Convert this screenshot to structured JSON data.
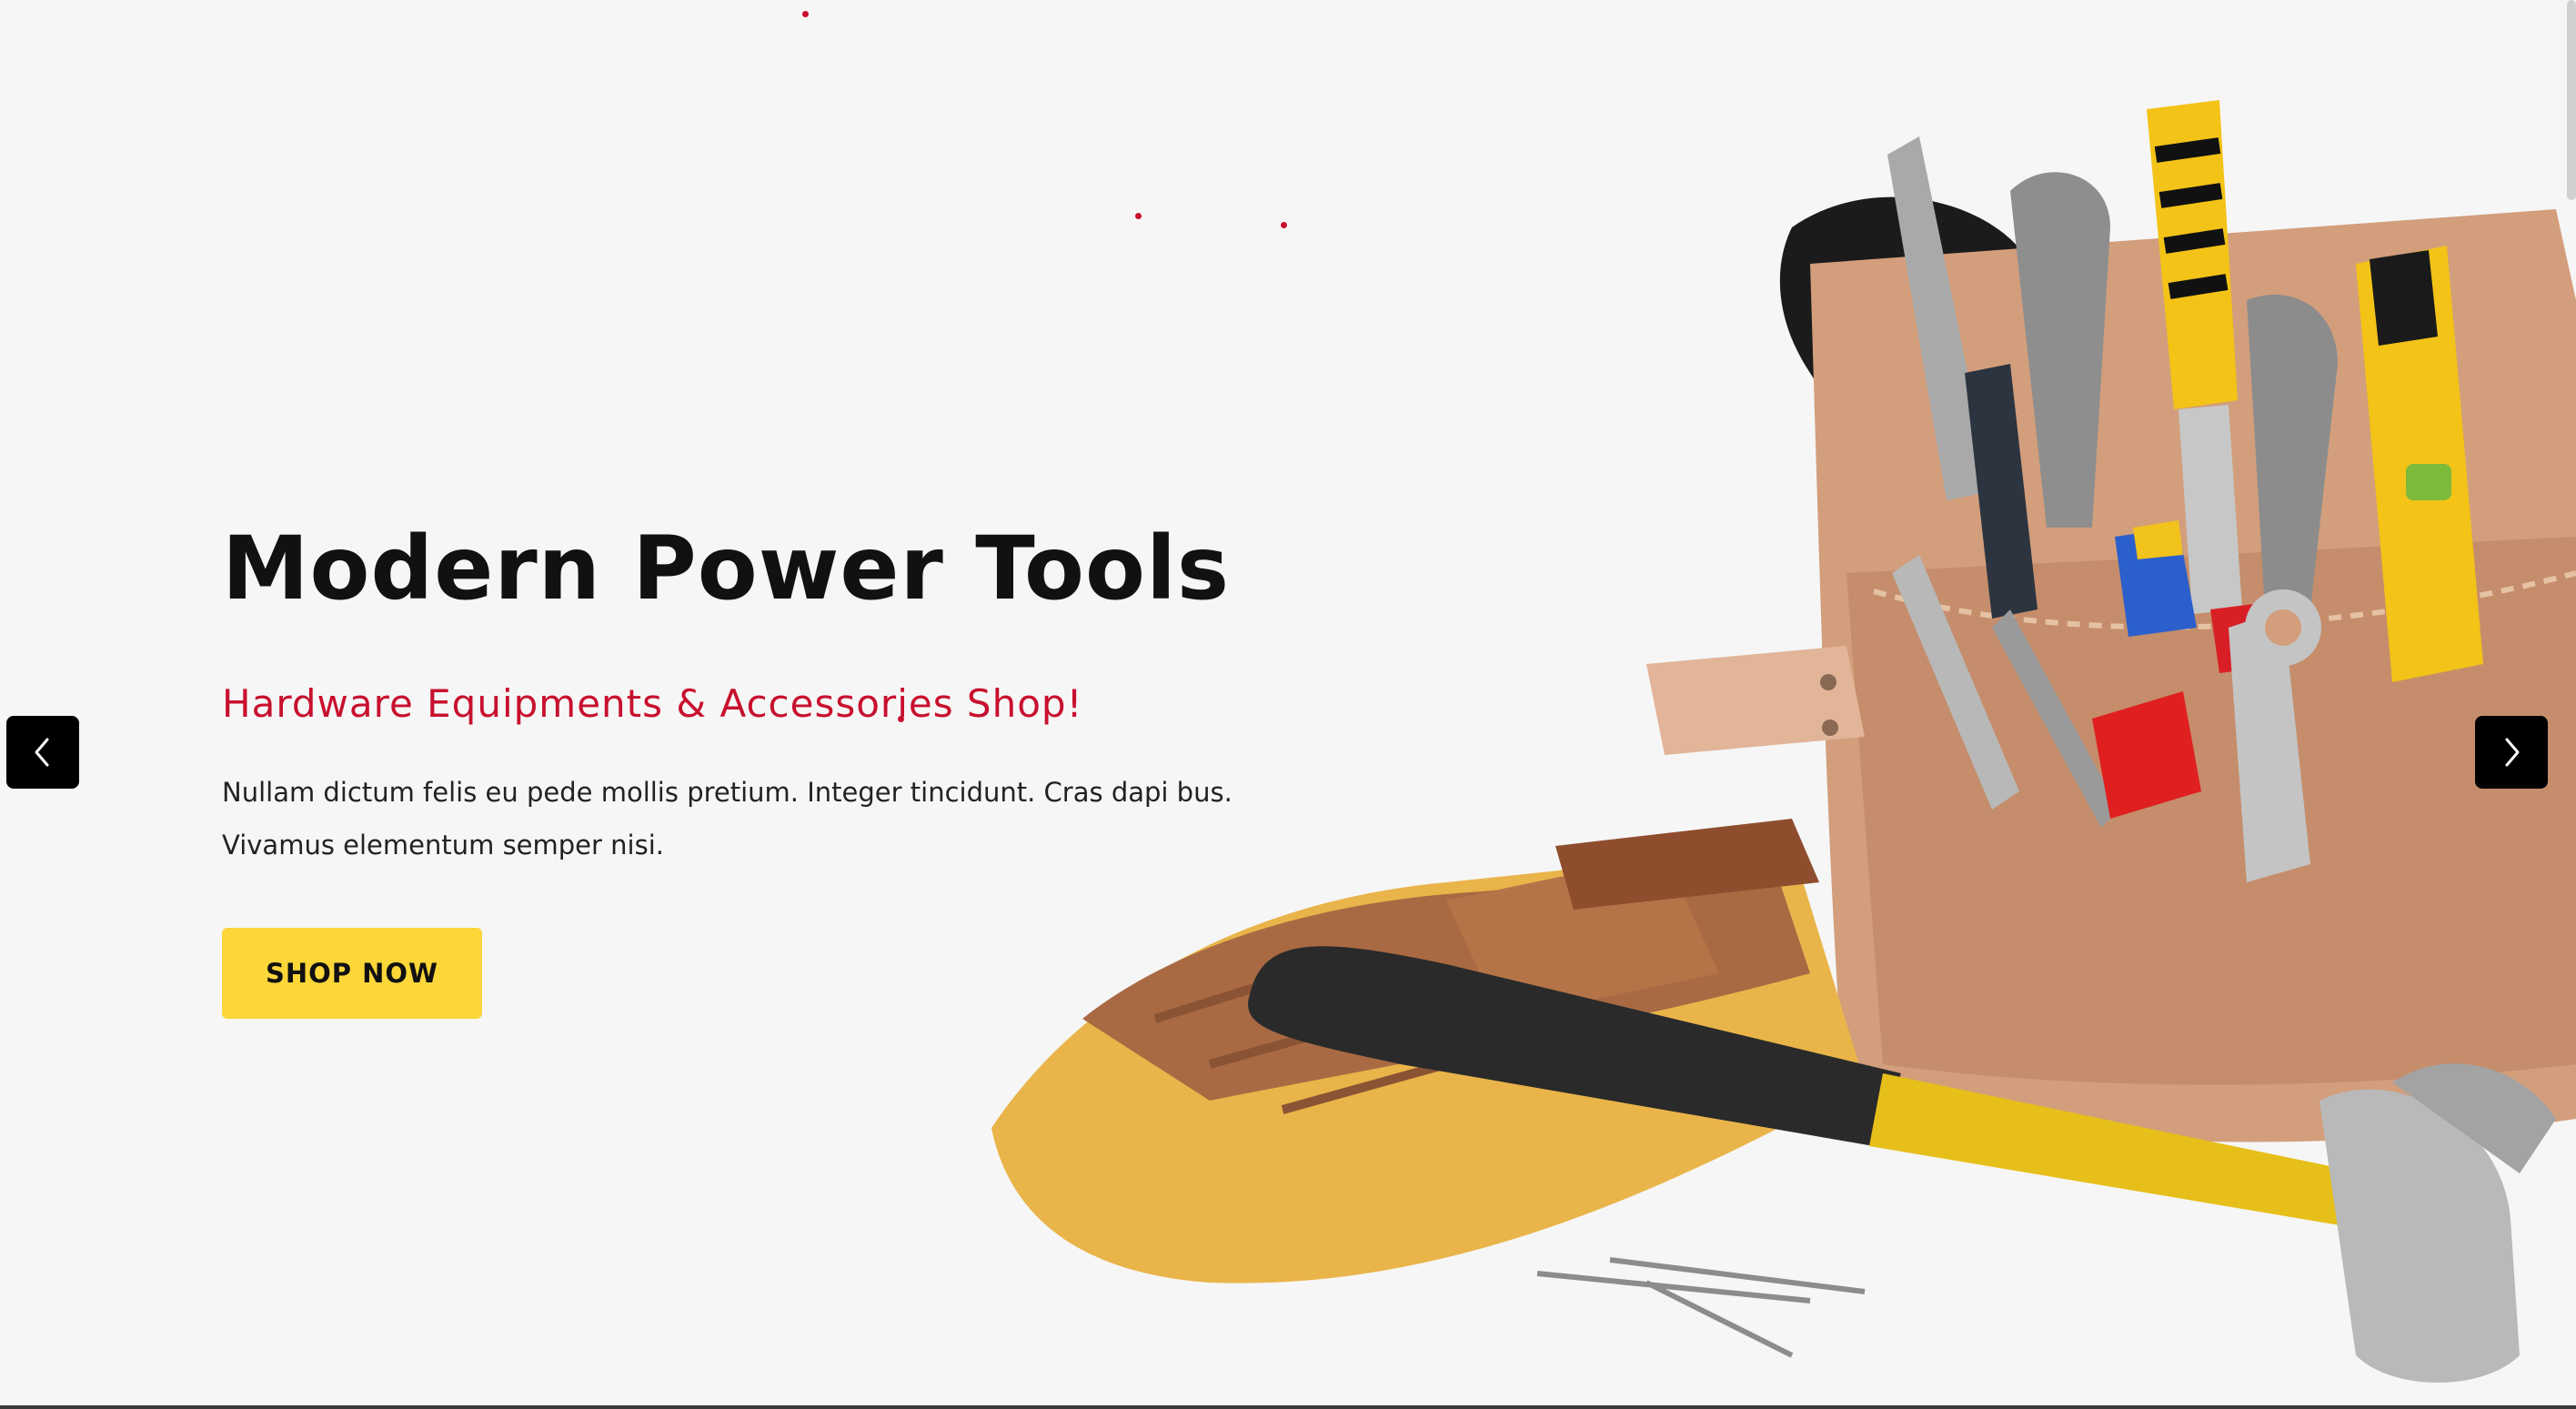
{
  "hero": {
    "title": "Modern Power Tools",
    "subtitle": "Hardware Equipments & Accessories Shop!",
    "description_line1": "Nullam dictum felis eu pede mollis pretium. Integer tincidunt. Cras dapi bus.",
    "description_line2": "Vivamus elementum semper nisi.",
    "cta_label": "SHOP NOW"
  },
  "carousel": {
    "prev_icon": "chevron-left-icon",
    "next_icon": "chevron-right-icon"
  },
  "colors": {
    "background": "#f6f6f6",
    "accent_red": "#c8102e",
    "button_yellow": "#fdd63a",
    "title_text": "#111111",
    "arrow_bg": "#000000"
  }
}
